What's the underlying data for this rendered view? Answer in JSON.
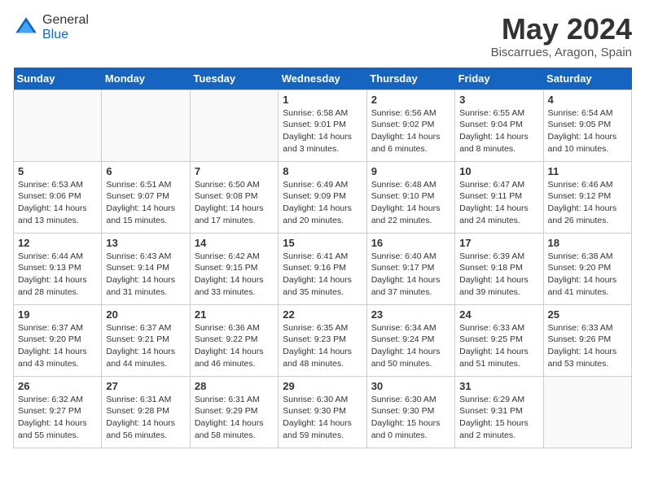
{
  "header": {
    "logo_general": "General",
    "logo_blue": "Blue",
    "month_title": "May 2024",
    "location": "Biscarrues, Aragon, Spain"
  },
  "days_of_week": [
    "Sunday",
    "Monday",
    "Tuesday",
    "Wednesday",
    "Thursday",
    "Friday",
    "Saturday"
  ],
  "weeks": [
    [
      {
        "num": "",
        "info": ""
      },
      {
        "num": "",
        "info": ""
      },
      {
        "num": "",
        "info": ""
      },
      {
        "num": "1",
        "info": "Sunrise: 6:58 AM\nSunset: 9:01 PM\nDaylight: 14 hours\nand 3 minutes."
      },
      {
        "num": "2",
        "info": "Sunrise: 6:56 AM\nSunset: 9:02 PM\nDaylight: 14 hours\nand 6 minutes."
      },
      {
        "num": "3",
        "info": "Sunrise: 6:55 AM\nSunset: 9:04 PM\nDaylight: 14 hours\nand 8 minutes."
      },
      {
        "num": "4",
        "info": "Sunrise: 6:54 AM\nSunset: 9:05 PM\nDaylight: 14 hours\nand 10 minutes."
      }
    ],
    [
      {
        "num": "5",
        "info": "Sunrise: 6:53 AM\nSunset: 9:06 PM\nDaylight: 14 hours\nand 13 minutes."
      },
      {
        "num": "6",
        "info": "Sunrise: 6:51 AM\nSunset: 9:07 PM\nDaylight: 14 hours\nand 15 minutes."
      },
      {
        "num": "7",
        "info": "Sunrise: 6:50 AM\nSunset: 9:08 PM\nDaylight: 14 hours\nand 17 minutes."
      },
      {
        "num": "8",
        "info": "Sunrise: 6:49 AM\nSunset: 9:09 PM\nDaylight: 14 hours\nand 20 minutes."
      },
      {
        "num": "9",
        "info": "Sunrise: 6:48 AM\nSunset: 9:10 PM\nDaylight: 14 hours\nand 22 minutes."
      },
      {
        "num": "10",
        "info": "Sunrise: 6:47 AM\nSunset: 9:11 PM\nDaylight: 14 hours\nand 24 minutes."
      },
      {
        "num": "11",
        "info": "Sunrise: 6:46 AM\nSunset: 9:12 PM\nDaylight: 14 hours\nand 26 minutes."
      }
    ],
    [
      {
        "num": "12",
        "info": "Sunrise: 6:44 AM\nSunset: 9:13 PM\nDaylight: 14 hours\nand 28 minutes."
      },
      {
        "num": "13",
        "info": "Sunrise: 6:43 AM\nSunset: 9:14 PM\nDaylight: 14 hours\nand 31 minutes."
      },
      {
        "num": "14",
        "info": "Sunrise: 6:42 AM\nSunset: 9:15 PM\nDaylight: 14 hours\nand 33 minutes."
      },
      {
        "num": "15",
        "info": "Sunrise: 6:41 AM\nSunset: 9:16 PM\nDaylight: 14 hours\nand 35 minutes."
      },
      {
        "num": "16",
        "info": "Sunrise: 6:40 AM\nSunset: 9:17 PM\nDaylight: 14 hours\nand 37 minutes."
      },
      {
        "num": "17",
        "info": "Sunrise: 6:39 AM\nSunset: 9:18 PM\nDaylight: 14 hours\nand 39 minutes."
      },
      {
        "num": "18",
        "info": "Sunrise: 6:38 AM\nSunset: 9:20 PM\nDaylight: 14 hours\nand 41 minutes."
      }
    ],
    [
      {
        "num": "19",
        "info": "Sunrise: 6:37 AM\nSunset: 9:20 PM\nDaylight: 14 hours\nand 43 minutes."
      },
      {
        "num": "20",
        "info": "Sunrise: 6:37 AM\nSunset: 9:21 PM\nDaylight: 14 hours\nand 44 minutes."
      },
      {
        "num": "21",
        "info": "Sunrise: 6:36 AM\nSunset: 9:22 PM\nDaylight: 14 hours\nand 46 minutes."
      },
      {
        "num": "22",
        "info": "Sunrise: 6:35 AM\nSunset: 9:23 PM\nDaylight: 14 hours\nand 48 minutes."
      },
      {
        "num": "23",
        "info": "Sunrise: 6:34 AM\nSunset: 9:24 PM\nDaylight: 14 hours\nand 50 minutes."
      },
      {
        "num": "24",
        "info": "Sunrise: 6:33 AM\nSunset: 9:25 PM\nDaylight: 14 hours\nand 51 minutes."
      },
      {
        "num": "25",
        "info": "Sunrise: 6:33 AM\nSunset: 9:26 PM\nDaylight: 14 hours\nand 53 minutes."
      }
    ],
    [
      {
        "num": "26",
        "info": "Sunrise: 6:32 AM\nSunset: 9:27 PM\nDaylight: 14 hours\nand 55 minutes."
      },
      {
        "num": "27",
        "info": "Sunrise: 6:31 AM\nSunset: 9:28 PM\nDaylight: 14 hours\nand 56 minutes."
      },
      {
        "num": "28",
        "info": "Sunrise: 6:31 AM\nSunset: 9:29 PM\nDaylight: 14 hours\nand 58 minutes."
      },
      {
        "num": "29",
        "info": "Sunrise: 6:30 AM\nSunset: 9:30 PM\nDaylight: 14 hours\nand 59 minutes."
      },
      {
        "num": "30",
        "info": "Sunrise: 6:30 AM\nSunset: 9:30 PM\nDaylight: 15 hours\nand 0 minutes."
      },
      {
        "num": "31",
        "info": "Sunrise: 6:29 AM\nSunset: 9:31 PM\nDaylight: 15 hours\nand 2 minutes."
      },
      {
        "num": "",
        "info": ""
      }
    ]
  ]
}
